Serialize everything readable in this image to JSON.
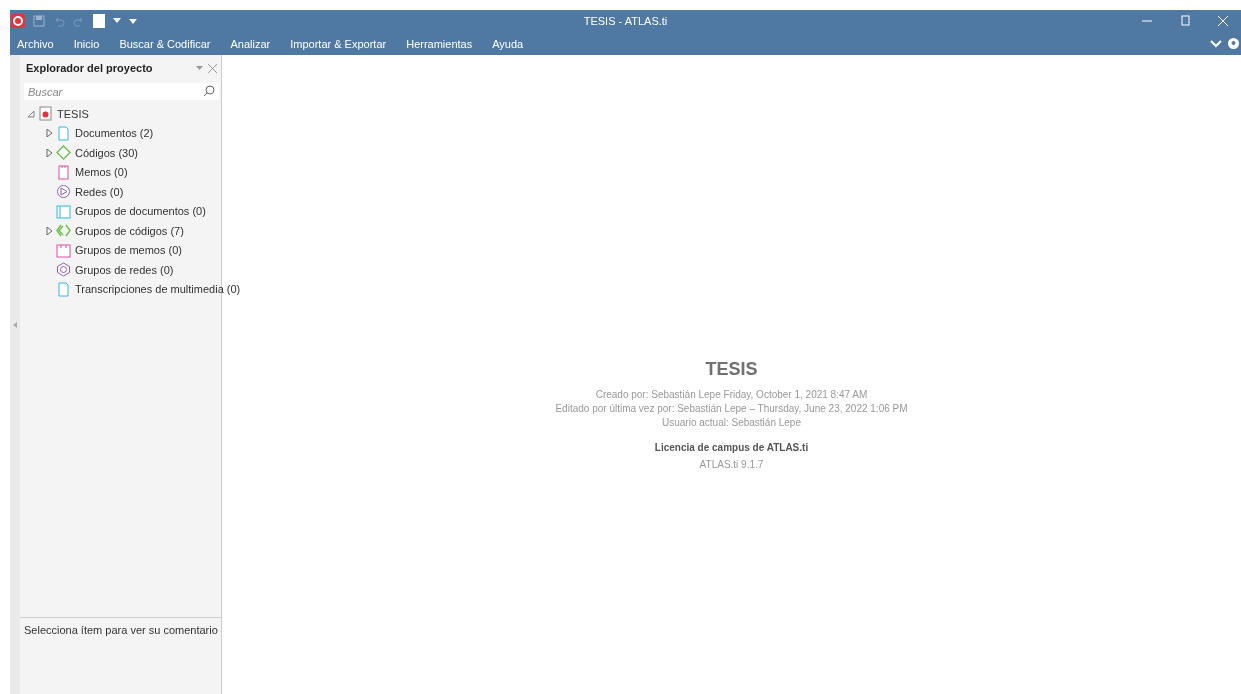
{
  "window": {
    "title": "TESIS - ATLAS.ti"
  },
  "menu": [
    {
      "label": "Archivo"
    },
    {
      "label": "Inicio"
    },
    {
      "label": "Buscar & Codificar"
    },
    {
      "label": "Analizar"
    },
    {
      "label": "Importar & Exportar"
    },
    {
      "label": "Herramientas"
    },
    {
      "label": "Ayuda"
    }
  ],
  "explorer": {
    "title": "Explorador del proyecto",
    "search": {
      "placeholder": "Buscar"
    },
    "tree": [
      {
        "label": "TESIS",
        "kind": "project",
        "expanded": true,
        "children": [
          {
            "label": "Documentos (2)",
            "kind": "document",
            "expanded": false
          },
          {
            "label": "Códigos (30)",
            "kind": "code",
            "expanded": false
          },
          {
            "label": "Memos (0)",
            "kind": "memo"
          },
          {
            "label": "Redes (0)",
            "kind": "network"
          },
          {
            "label": "Grupos de documentos (0)",
            "kind": "docgroup"
          },
          {
            "label": "Grupos de códigos (7)",
            "kind": "codegroup",
            "expanded": false
          },
          {
            "label": "Grupos de memos (0)",
            "kind": "memogroup"
          },
          {
            "label": "Grupos de redes (0)",
            "kind": "netgroup"
          },
          {
            "label": "Transcripciones de multimedia (0)",
            "kind": "transcript"
          }
        ]
      }
    ],
    "comment": "Selecciona ítem para ver su comentario"
  },
  "project": {
    "title": "TESIS",
    "lines": [
      "Creado por: Sebastián  Lepe    Friday, October 1, 2021 8:47 AM",
      "Editado por última vez por: Sebastián  Lepe – Thursday, June 23, 2022 1:06 PM",
      "Usuario actual: Sebastián  Lepe"
    ],
    "license": "Licencia de campus de ATLAS.ti",
    "version": "ATLAS.ti 9.1.7"
  }
}
